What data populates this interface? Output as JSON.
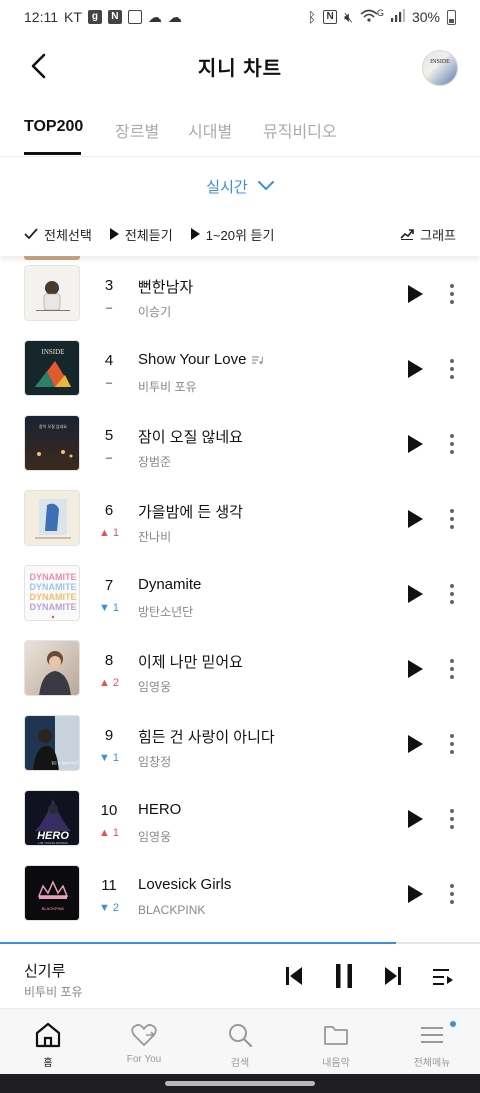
{
  "status_bar": {
    "time": "12:11",
    "carrier": "KT",
    "battery": "30%",
    "network": "G"
  },
  "header": {
    "title": "지니 차트",
    "avatar_text": "INSIDE"
  },
  "tabs": [
    {
      "label": "TOP200",
      "active": true
    },
    {
      "label": "장르별",
      "active": false
    },
    {
      "label": "시대별",
      "active": false
    },
    {
      "label": "뮤직비디오",
      "active": false
    }
  ],
  "filter": {
    "label": "실시간"
  },
  "actions": {
    "select_all": "전체선택",
    "play_all": "전체듣기",
    "play_top20": "1~20위 듣기",
    "graph": "그래프"
  },
  "chart": [
    {
      "rank": "3",
      "change": "–",
      "dir": "same",
      "title": "뻔한남자",
      "artist": "이승기",
      "lyrics": false
    },
    {
      "rank": "4",
      "change": "–",
      "dir": "same",
      "title": "Show Your Love",
      "artist": "비투비 포유",
      "lyrics": true
    },
    {
      "rank": "5",
      "change": "–",
      "dir": "same",
      "title": "잠이 오질 않네요",
      "artist": "장범준",
      "lyrics": false
    },
    {
      "rank": "6",
      "change": "1",
      "dir": "up",
      "title": "가을밤에 든 생각",
      "artist": "잔나비",
      "lyrics": false
    },
    {
      "rank": "7",
      "change": "1",
      "dir": "down",
      "title": "Dynamite",
      "artist": "방탄소년단",
      "lyrics": false
    },
    {
      "rank": "8",
      "change": "2",
      "dir": "up",
      "title": "이제 나만 믿어요",
      "artist": "임영웅",
      "lyrics": false
    },
    {
      "rank": "9",
      "change": "1",
      "dir": "down",
      "title": "힘든 건 사랑이 아니다",
      "artist": "임창정",
      "lyrics": false
    },
    {
      "rank": "10",
      "change": "1",
      "dir": "up",
      "title": "HERO",
      "artist": "임영웅",
      "lyrics": false
    },
    {
      "rank": "11",
      "change": "2",
      "dir": "down",
      "title": "Lovesick Girls",
      "artist": "BLACKPINK",
      "lyrics": false
    }
  ],
  "covers": {
    "r4": "INSIDE",
    "r5": "잠이 오질 않네요",
    "r7": "DYNAMITE",
    "r9": "힘든 건 사랑이 아니다",
    "r10": "HERO",
    "r10_sub": "LIM YOUNG WOONG",
    "r11": "BLACKPINK"
  },
  "now_playing": {
    "title": "신기루",
    "artist": "비투비 포유",
    "progress": 0.825
  },
  "bottom_nav": [
    {
      "label": "홈",
      "icon": "home-icon",
      "active": true
    },
    {
      "label": "For You",
      "icon": "heart-icon",
      "active": false
    },
    {
      "label": "검색",
      "icon": "search-icon",
      "active": false
    },
    {
      "label": "내음악",
      "icon": "folder-icon",
      "active": false
    },
    {
      "label": "전체메뉴",
      "icon": "menu-icon",
      "active": false
    }
  ],
  "colors": {
    "accent": "#3b8fe0",
    "up": "#e8505b",
    "down": "#3b8fe0"
  }
}
